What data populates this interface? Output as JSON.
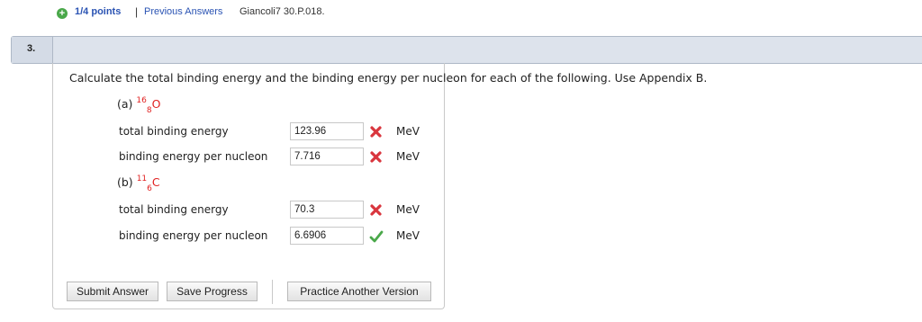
{
  "header": {
    "question_number": "3.",
    "plus_icon": "plus-circle-icon",
    "points": "1/4 points",
    "separator": "|",
    "previous_answers": "Previous Answers",
    "source": "Giancoli7 30.P.018."
  },
  "prompt": "Calculate the total binding energy and the binding energy per nucleon for each of the following. Use Appendix B.",
  "parts": [
    {
      "label": "(a)",
      "nuclide": {
        "mass": "16",
        "atomic": "8",
        "symbol": "O"
      },
      "rows": [
        {
          "label": "total binding energy",
          "value": "123.96",
          "status": "incorrect",
          "icon": "x-icon",
          "unit": "MeV"
        },
        {
          "label": "binding energy per nucleon",
          "value": "7.716",
          "status": "incorrect",
          "icon": "x-icon",
          "unit": "MeV"
        }
      ]
    },
    {
      "label": "(b)",
      "nuclide": {
        "mass": "11",
        "atomic": "6",
        "symbol": "C"
      },
      "rows": [
        {
          "label": "total binding energy",
          "value": "70.3",
          "status": "incorrect",
          "icon": "x-icon",
          "unit": "MeV"
        },
        {
          "label": "binding energy per nucleon",
          "value": "6.6906",
          "status": "correct",
          "icon": "check-icon",
          "unit": "MeV"
        }
      ]
    }
  ],
  "buttons": {
    "submit": "Submit Answer",
    "save": "Save Progress",
    "practice": "Practice Another Version"
  },
  "colors": {
    "nuclide": "#e02020",
    "incorrect": "#d9363e",
    "correct": "#4aa84a",
    "link": "#2a53b3"
  }
}
